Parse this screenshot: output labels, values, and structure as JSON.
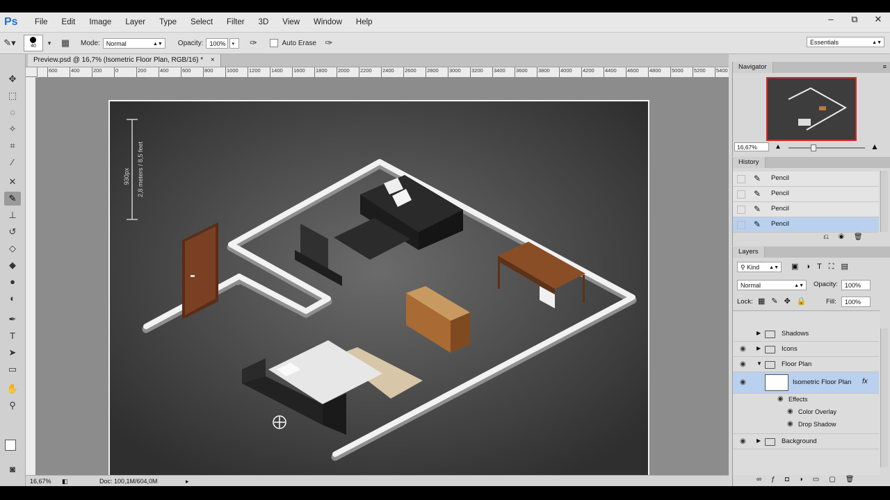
{
  "menu": {
    "logo": "Ps",
    "items": [
      "File",
      "Edit",
      "Image",
      "Layer",
      "Type",
      "Select",
      "Filter",
      "3D",
      "View",
      "Window",
      "Help"
    ],
    "window_controls": [
      "–",
      "⧉",
      "✕"
    ]
  },
  "options": {
    "brush_size": "40",
    "mode_label": "Mode:",
    "mode_value": "Normal",
    "opacity_label": "Opacity:",
    "opacity_value": "100%",
    "auto_erase_label": "Auto Erase",
    "workspace": "Essentials"
  },
  "document": {
    "tab_title": "Preview.psd @ 16,7% (Isometric Floor Plan, RGB/16) *",
    "tab_close": "×",
    "ruler_ticks": [
      "600",
      "400",
      "200",
      "0",
      "200",
      "400",
      "600",
      "800",
      "1000",
      "1200",
      "1400",
      "1600",
      "1800",
      "2000",
      "2200",
      "2400",
      "2600",
      "2800",
      "3000",
      "3200",
      "3400",
      "3600",
      "3800",
      "4000",
      "4200",
      "4400",
      "4600",
      "4800",
      "5000",
      "5200",
      "5400"
    ],
    "dimension_px": "930px",
    "dimension_m": "2,8 meters / 8,5 feet",
    "zoom": "16,67%",
    "doc_size": "Doc: 100,1M/604,0M"
  },
  "navigator": {
    "tab": "Navigator",
    "zoom": "16,67%"
  },
  "history": {
    "tab": "History",
    "items": [
      {
        "label": "Pencil"
      },
      {
        "label": "Pencil"
      },
      {
        "label": "Pencil"
      },
      {
        "label": "Pencil"
      }
    ]
  },
  "layers": {
    "tab": "Layers",
    "kind": "Kind",
    "blend_mode": "Normal",
    "opacity_label": "Opacity:",
    "opacity_value": "100%",
    "lock_label": "Lock:",
    "fill_label": "Fill:",
    "fill_value": "100%",
    "rows": [
      {
        "name": "Shadows"
      },
      {
        "name": "Icons"
      },
      {
        "name": "Floor Plan"
      },
      {
        "name": "Isometric Floor Plan"
      },
      {
        "name": "Effects"
      },
      {
        "name": "Color Overlay"
      },
      {
        "name": "Drop Shadow"
      },
      {
        "name": "Background"
      }
    ],
    "fx": "fx"
  },
  "colors": {
    "accent": "#1d74c4",
    "selection": "#b9d1ee",
    "canvas_bg": "#8c8c8c",
    "floor": "#3c3c3c"
  }
}
